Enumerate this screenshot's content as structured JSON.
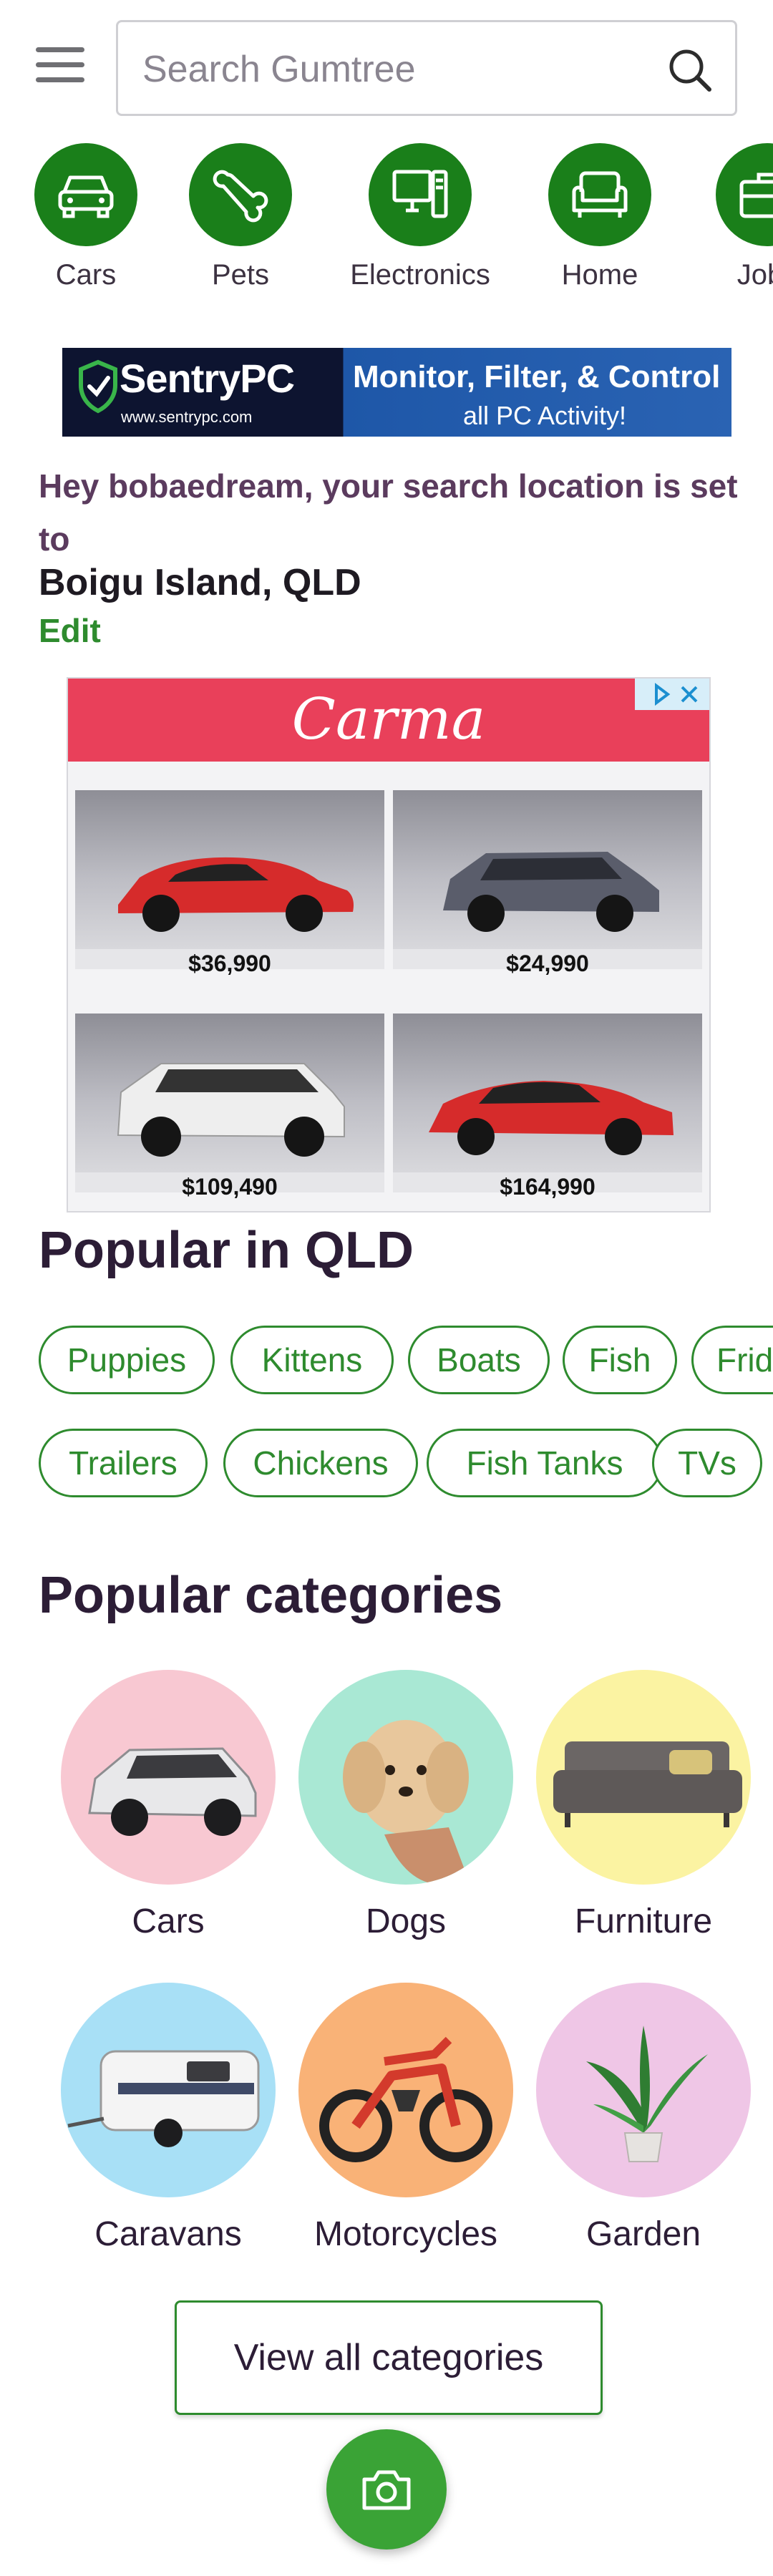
{
  "header": {
    "search_placeholder": "Search Gumtree"
  },
  "category_row": [
    {
      "label": "Cars",
      "icon": "car-icon"
    },
    {
      "label": "Pets",
      "icon": "bone-icon"
    },
    {
      "label": "Electronics",
      "icon": "computer-icon"
    },
    {
      "label": "Home",
      "icon": "sofa-icon"
    },
    {
      "label": "Jobs",
      "icon": "briefcase-icon"
    }
  ],
  "banner_ad": {
    "brand": "SentryPC",
    "url": "www.sentrypc.com",
    "tagline_line1": "Monitor, Filter, & Control",
    "tagline_line2": "all PC Activity!"
  },
  "location": {
    "intro": "Hey bobaedream, your search location is set to",
    "place": "Boigu Island, QLD",
    "edit_label": "Edit"
  },
  "carma_ad": {
    "brand": "Carma",
    "listings": [
      {
        "price": "$36,990",
        "color": "#d62b2b"
      },
      {
        "price": "$24,990",
        "color": "#5a5d6b"
      },
      {
        "price": "$109,490",
        "color": "#eeeeee"
      },
      {
        "price": "$164,990",
        "color": "#d62b2b"
      }
    ]
  },
  "popular_region": {
    "title": "Popular in QLD",
    "row1": [
      "Puppies",
      "Kittens",
      "Boats",
      "Fish",
      "Fridges"
    ],
    "row2": [
      "Trailers",
      "Chickens",
      "Fish Tanks",
      "TVs"
    ]
  },
  "popular_categories": {
    "title": "Popular categories",
    "items": [
      {
        "label": "Cars",
        "bg": "#f8c8d2"
      },
      {
        "label": "Dogs",
        "bg": "#a9e8d4"
      },
      {
        "label": "Furniture",
        "bg": "#fbf3a2"
      },
      {
        "label": "Caravans",
        "bg": "#a8e0f6"
      },
      {
        "label": "Motorcycles",
        "bg": "#f9b277"
      },
      {
        "label": "Garden",
        "bg": "#efc6e6"
      }
    ],
    "view_all_label": "View all categories"
  },
  "colors": {
    "brand_green": "#1a7f1a",
    "link_green": "#2e8b2e",
    "fab_green": "#3aa336"
  }
}
